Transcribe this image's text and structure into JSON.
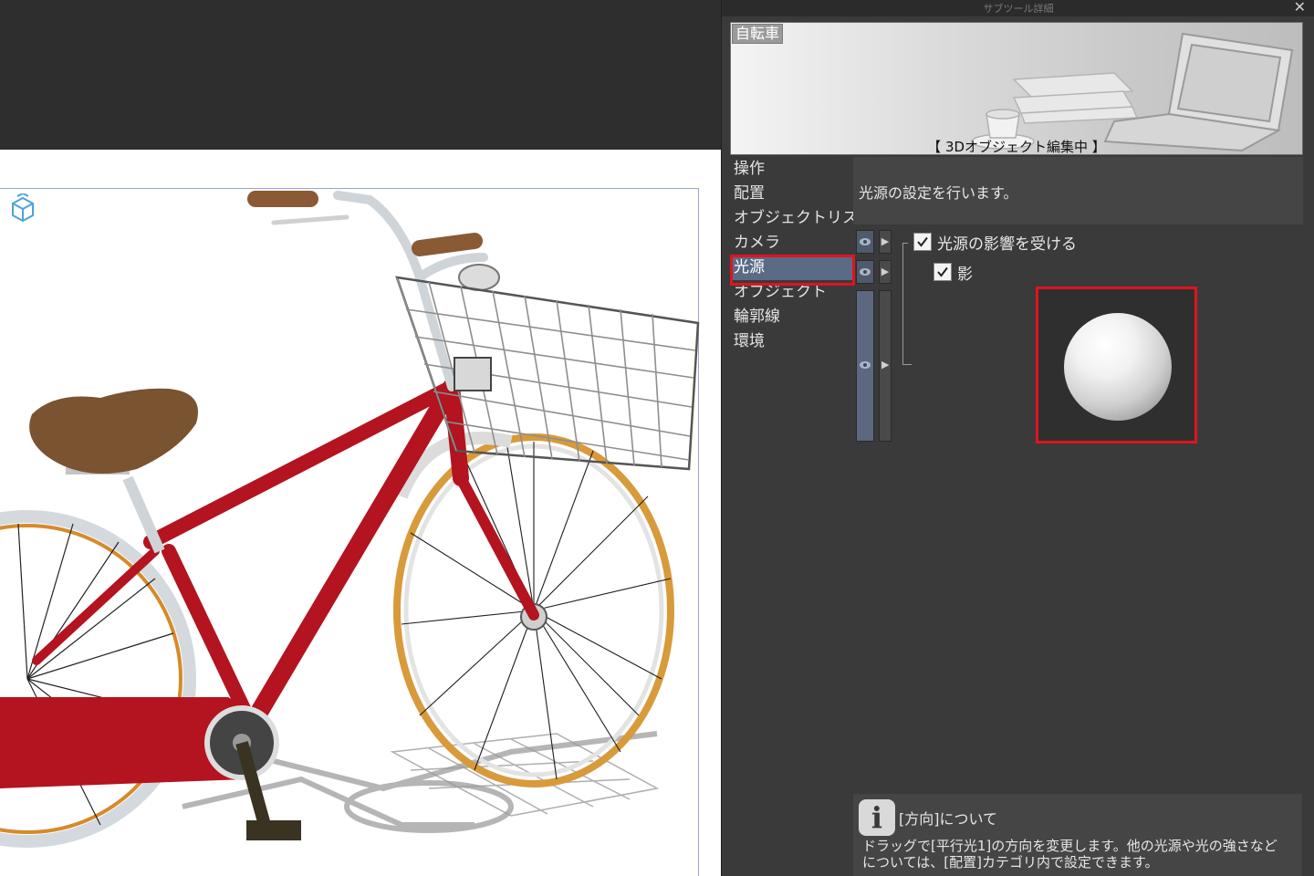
{
  "panel": {
    "title": "サブツール詳細",
    "close": "✕",
    "preview": {
      "tag": "自転車",
      "caption": "【 3Dオブジェクト編集中 】"
    },
    "categories": [
      {
        "label": "操作",
        "active": false
      },
      {
        "label": "配置",
        "active": false
      },
      {
        "label": "オブジェクトリスト",
        "active": false
      },
      {
        "label": "カメラ",
        "active": false
      },
      {
        "label": "光源",
        "active": true
      },
      {
        "label": "オブジェクト",
        "active": false
      },
      {
        "label": "輪郭線",
        "active": false
      },
      {
        "label": "環境",
        "active": false
      }
    ],
    "description": "光源の設定を行います。",
    "settings": {
      "affected_by_light": {
        "label": "光源の影響を受ける",
        "checked": true
      },
      "shadow": {
        "label": "影",
        "checked": true
      }
    },
    "help": {
      "icon": "i",
      "title": "[方向]について",
      "line1": "ドラッグで[平行光1]の方向を変更します。他の光源や光の強さなど",
      "line2": "については、[配置]カテゴリ内で設定できます。"
    }
  },
  "colors": {
    "highlight": "#e0141e",
    "active_category": "#5b6a85",
    "bike_frame": "#b3141f",
    "saddle": "#7a5330"
  }
}
